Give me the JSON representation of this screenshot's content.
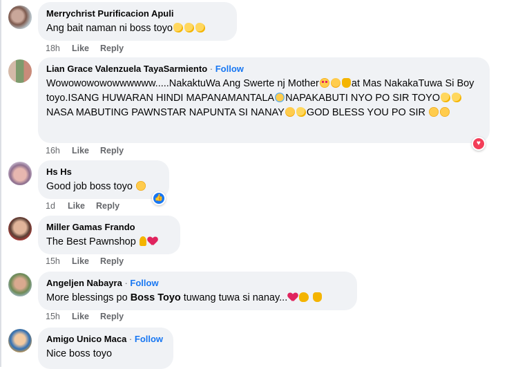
{
  "comments": [
    {
      "name": "Merrychrist Purificacion Apuli",
      "follow": "",
      "text_parts": [
        "Ang bait naman ni boss toyo"
      ],
      "time": "18h",
      "like": "Like",
      "reply": "Reply"
    },
    {
      "name": "Lian Grace Valenzuela TayaSarmiento",
      "separator": "·",
      "follow": "Follow",
      "text_parts": [
        "Wowowowowowwwwww.....NakaktuWa Ang Swerte nj Mother",
        "at Mas NakakaTuwa Si Boy toyo.ISANG HUWARAN HINDI MAPANAMANTALA",
        "NAPAKABUTI NYO PO SIR TOYO",
        "NASA MABUTING PAWNSTAR NAPUNTA SI NANAY",
        "GOD BLESS YOU PO SIR"
      ],
      "time": "16h",
      "like": "Like",
      "reply": "Reply",
      "reaction": "love"
    },
    {
      "name": "Hs Hs",
      "follow": "",
      "text_parts": [
        "Good job boss toyo"
      ],
      "time": "1d",
      "like": "Like",
      "reply": "Reply",
      "reaction": "like"
    },
    {
      "name": "Miller Gamas Frando",
      "follow": "",
      "text_parts": [
        "The Best Pawnshop"
      ],
      "time": "15h",
      "like": "Like",
      "reply": "Reply"
    },
    {
      "name": "Angeljen Nabayra",
      "separator": "·",
      "follow": "Follow",
      "text_parts": [
        "More blessings po ",
        "Boss Toyo",
        " tuwang tuwa si nanay..."
      ],
      "time": "15h",
      "like": "Like",
      "reply": "Reply"
    },
    {
      "name": "Amigo Unico Maca",
      "separator": "·",
      "follow": "Follow",
      "text_parts": [
        "Nice boss toyo"
      ]
    }
  ],
  "colors": {
    "bubble": "#f0f2f5",
    "follow": "#1877f2",
    "meta": "#65676b",
    "love": "#f33e58",
    "like": "#1877f2"
  }
}
